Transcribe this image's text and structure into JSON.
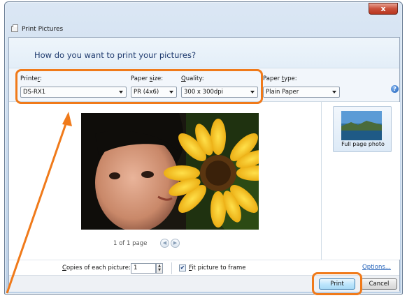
{
  "window": {
    "title": "Print Pictures",
    "close_glyph": "x"
  },
  "heading": "How do you want to print your pictures?",
  "printer": {
    "label_pre": "Printe",
    "label_ul": "r",
    "label_post": ":",
    "value": "DS-RX1"
  },
  "paper_size": {
    "label_pre": "Paper ",
    "label_ul": "s",
    "label_post": "ize:",
    "value": "PR (4x6)"
  },
  "quality": {
    "label_pre": "",
    "label_ul": "Q",
    "label_post": "uality:",
    "value": "300 x 300dpi"
  },
  "paper_type": {
    "label_pre": "Paper ",
    "label_ul": "t",
    "label_post": "ype:",
    "value": "Plain Paper"
  },
  "help_glyph": "?",
  "preview": {
    "page_info": "1 of 1 page",
    "prev_glyph": "◀",
    "next_glyph": "▶"
  },
  "layout": {
    "label": "Full page photo"
  },
  "copies": {
    "label_pre": "",
    "label_ul": "C",
    "label_post": "opies of each picture:",
    "value": "1",
    "up_glyph": "▲",
    "down_glyph": "▼"
  },
  "fit": {
    "label_pre": "",
    "label_ul": "F",
    "label_post": "it picture to frame",
    "checked_glyph": "✔"
  },
  "options_link": "Options...",
  "buttons": {
    "print": "Print",
    "cancel": "Cancel"
  },
  "colors": {
    "highlight": "#f07a1a",
    "heading": "#1e3a6e",
    "link": "#1f5fb8"
  }
}
